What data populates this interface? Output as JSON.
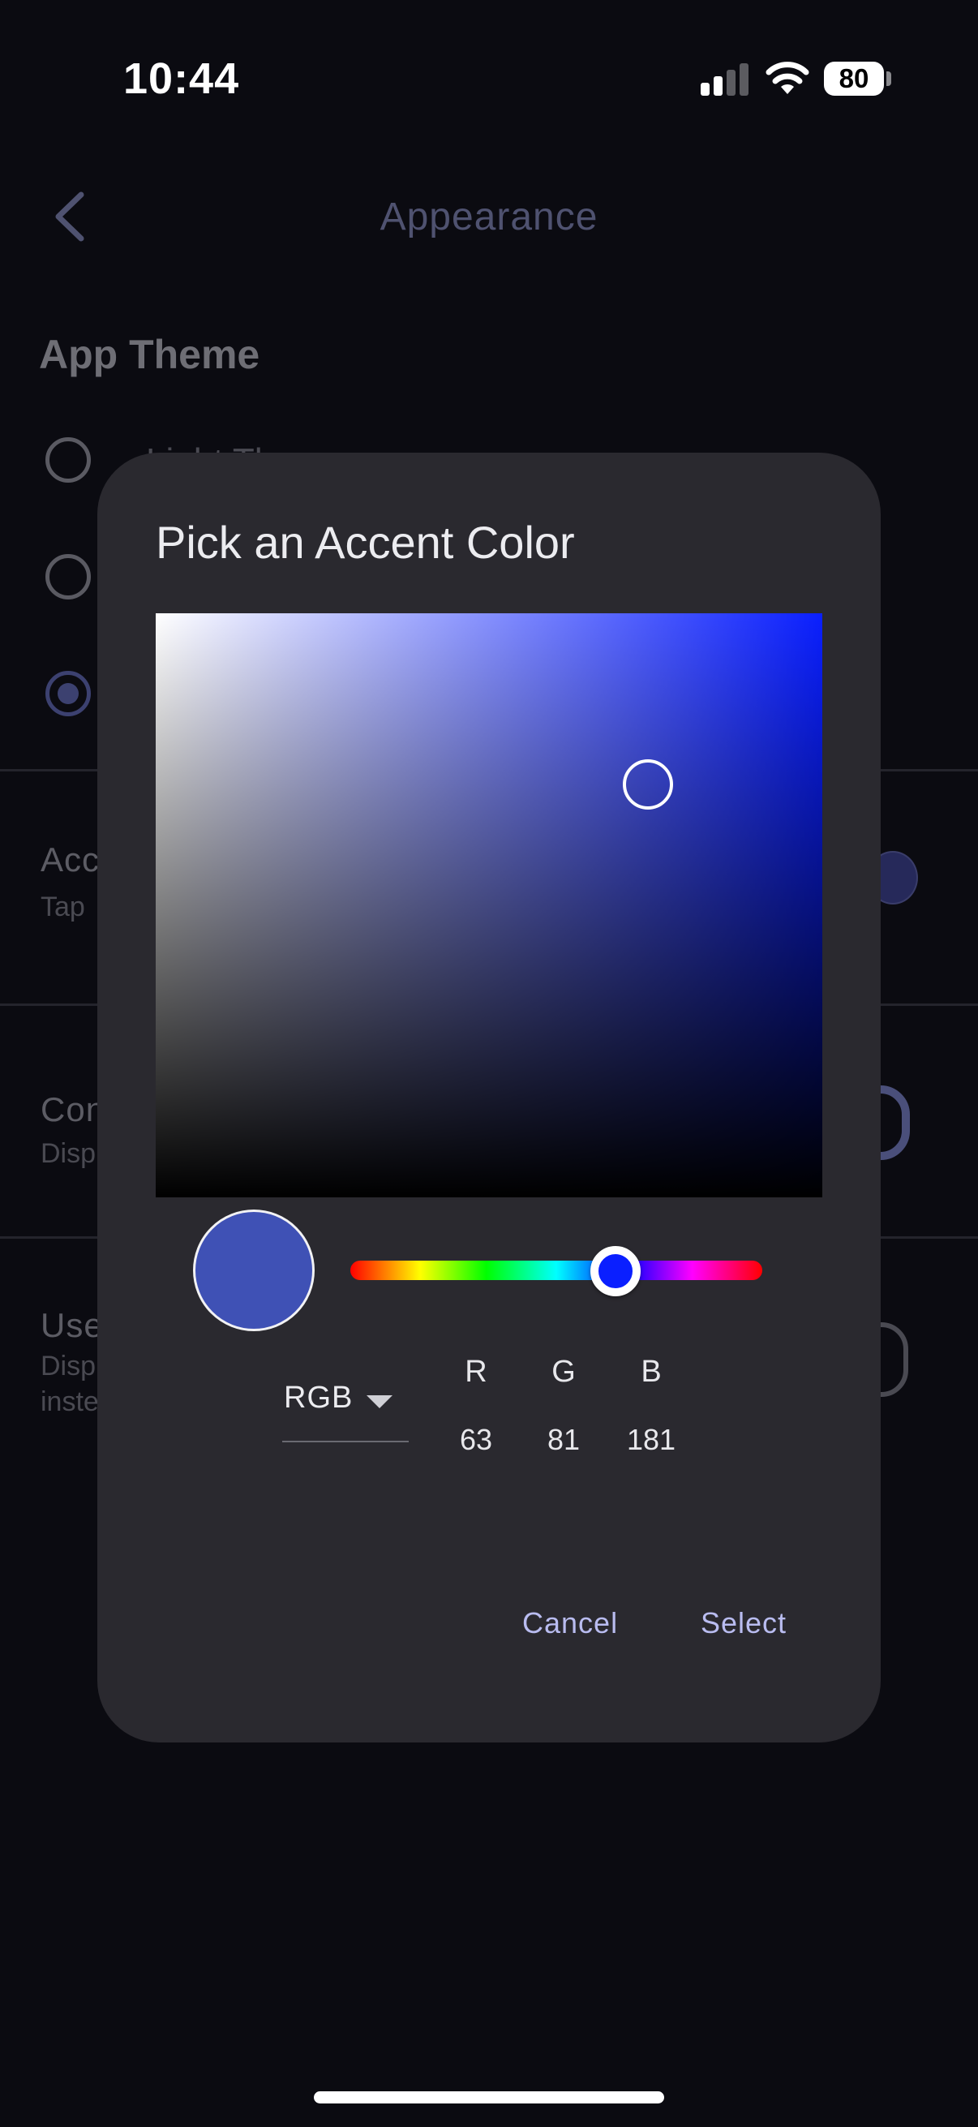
{
  "status_bar": {
    "time": "10:44",
    "battery": "80",
    "icons": [
      "signal-icon",
      "wifi-icon",
      "battery-icon"
    ]
  },
  "nav": {
    "title": "Appearance",
    "back_icon": "chevron-left-icon"
  },
  "app_theme": {
    "title": "App Theme",
    "options": [
      {
        "label": "Light Th",
        "selected": false
      },
      {
        "label": "",
        "selected": false
      },
      {
        "label": "",
        "selected": true
      }
    ]
  },
  "settings_rows": [
    {
      "title": "Acc",
      "subtitle": "Tap"
    },
    {
      "title": "Con",
      "subtitle": "Disp"
    },
    {
      "title": "Use",
      "subtitle": "Disp\ninste"
    }
  ],
  "dialog": {
    "title": "Pick an Accent Color",
    "hue_color": "#0a1fff",
    "selected_color": "#3f51b5",
    "mode": "RGB",
    "channels": [
      {
        "label": "R",
        "value": "63"
      },
      {
        "label": "G",
        "value": "81"
      },
      {
        "label": "B",
        "value": "181"
      }
    ],
    "cancel_label": "Cancel",
    "select_label": "Select"
  },
  "colors": {
    "background": "#0b0b11",
    "dialog": "#2a292f",
    "accent_text": "#b9bcf0",
    "muted_title": "#4f5270"
  }
}
